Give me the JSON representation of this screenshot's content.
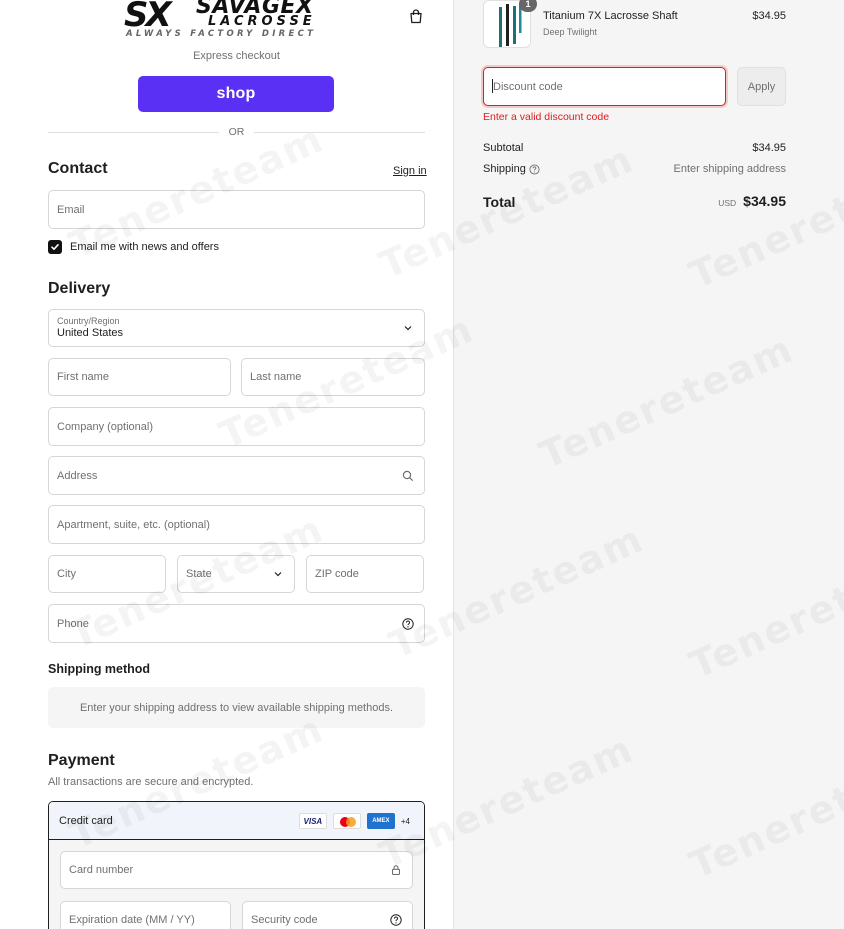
{
  "header": {
    "logo_mark": "SX",
    "logo_name": "SAVAGEX",
    "logo_sub": "LACROSSE",
    "logo_tagline": "ALWAYS FACTORY DIRECT",
    "cart_icon": "shopping-bag-icon"
  },
  "express": {
    "label": "Express checkout",
    "shop_button": "shop",
    "or_label": "OR",
    "accent": "#5a31f4"
  },
  "contact": {
    "title": "Contact",
    "sign_in": "Sign in",
    "email_placeholder": "Email",
    "news_checkbox_label": "Email me with news and offers",
    "news_checked": true
  },
  "delivery": {
    "title": "Delivery",
    "country_label": "Country/Region",
    "country_value": "United States",
    "first_name": "First name",
    "last_name": "Last name",
    "company": "Company (optional)",
    "address": "Address",
    "apartment": "Apartment, suite, etc. (optional)",
    "city": "City",
    "state": "State",
    "zip": "ZIP code",
    "phone": "Phone"
  },
  "shipping": {
    "title": "Shipping method",
    "message": "Enter your shipping address to view available shipping methods."
  },
  "payment": {
    "title": "Payment",
    "subtitle": "All transactions are secure and encrypted.",
    "method": "Credit card",
    "card_brands": [
      "VISA",
      "AMEX"
    ],
    "more_cards": "+4",
    "card_number": "Card number",
    "expiration": "Expiration date (MM / YY)",
    "security_code": "Security code"
  },
  "order": {
    "product_name": "Titanium 7X Lacrosse Shaft",
    "product_variant": "Deep Twilight",
    "quantity": "1",
    "product_price": "$34.95",
    "discount_placeholder": "Discount code",
    "apply": "Apply",
    "error": "Enter a valid discount code",
    "error_color": "#dd1d1d",
    "subtotal_label": "Subtotal",
    "subtotal_value": "$34.95",
    "shipping_label": "Shipping",
    "shipping_value": "Enter shipping address",
    "total_label": "Total",
    "total_currency": "USD",
    "total_value": "$34.95"
  },
  "watermark": {
    "text": "Tenereteam"
  }
}
